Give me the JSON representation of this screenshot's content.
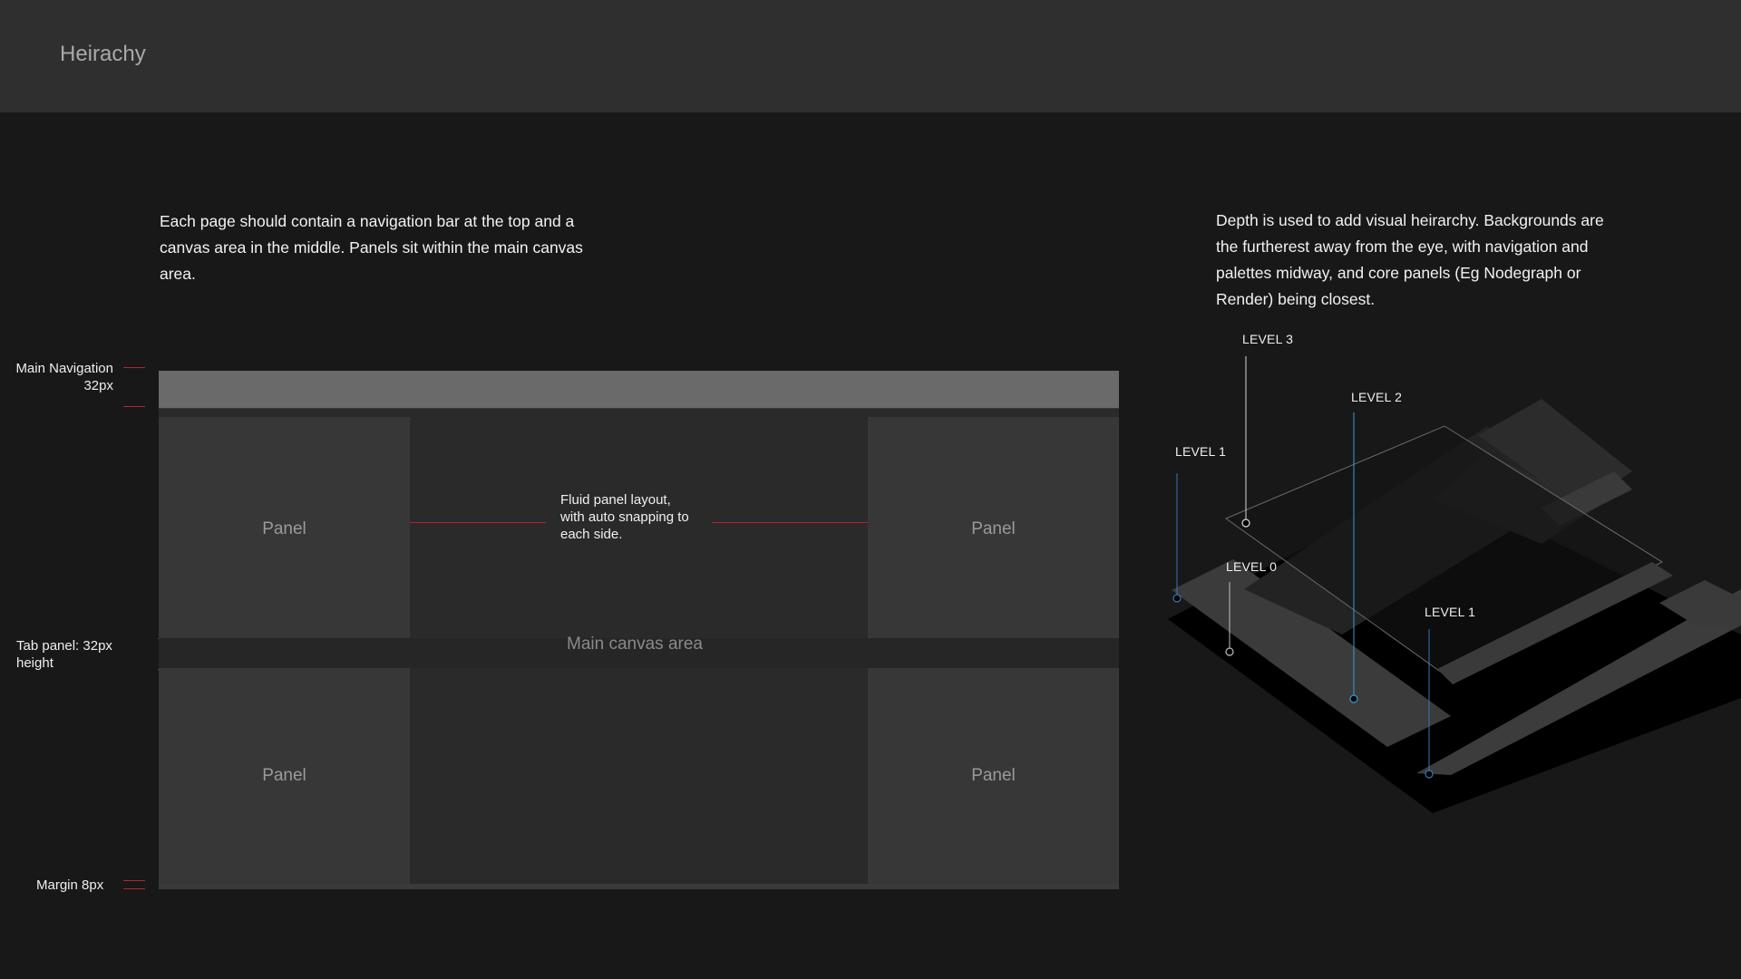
{
  "header": {
    "title": "Heirachy"
  },
  "left": {
    "description": "Each page should contain a navigation bar at the top and a canvas area in the middle. Panels sit within the main canvas area.",
    "annotations": {
      "main_nav_line1": "Main Navigation",
      "main_nav_line2": "32px",
      "tab_panel": "Tab panel: 32px height",
      "margin": "Margin 8px"
    },
    "layout": {
      "panel_label": "Panel",
      "canvas_label": "Main canvas area",
      "fluid_note": "Fluid panel layout, with auto snapping to each side."
    }
  },
  "right": {
    "description": "Depth is used to add visual heirarchy. Backgrounds are the furtherest away from the eye, with navigation and palettes midway, and core panels (Eg Nodegraph or Render) being closest.",
    "levels": {
      "level3": "LEVEL 3",
      "level2": "LEVEL 2",
      "level1_left": "LEVEL  1",
      "level0": "LEVEL 0",
      "level1_right": "LEVEL 1"
    }
  },
  "colors": {
    "background": "#181818",
    "header": "#2f2f2f",
    "annotation_red": "#b3262b",
    "level_line_blue": "#3a74b8"
  }
}
